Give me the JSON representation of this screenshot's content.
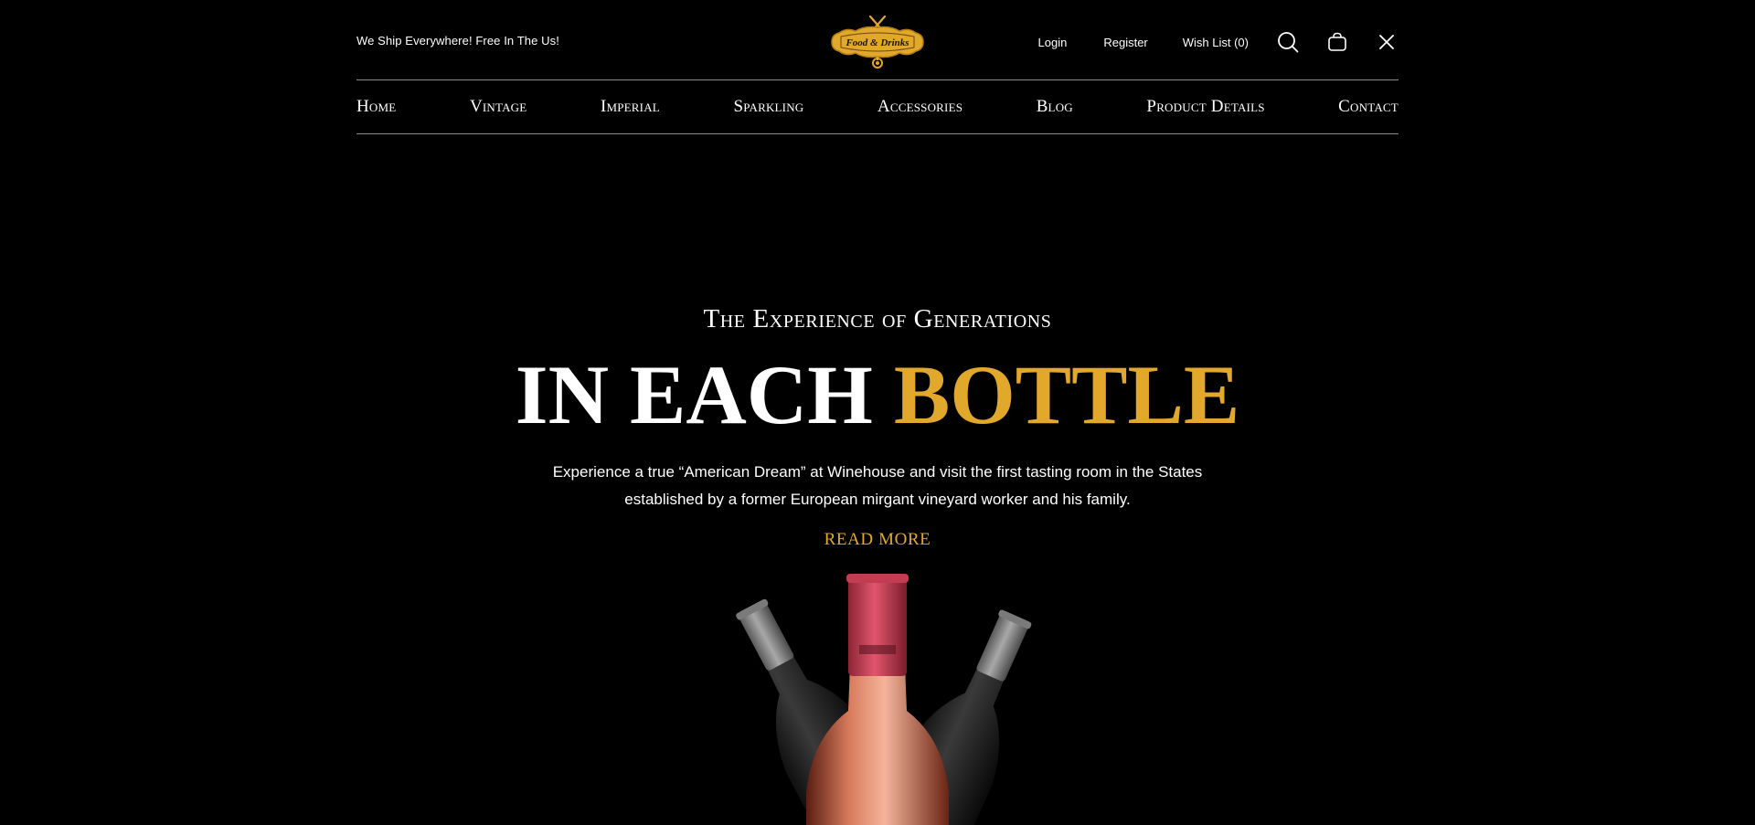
{
  "header": {
    "ship_note": "We Ship Everywhere! Free In The Us!",
    "logo_text": "Food & Drinks",
    "login": "Login",
    "register": "Register",
    "wishlist": "Wish List (0)"
  },
  "icons": {
    "search": "search-icon",
    "bag": "shopping-bag-icon",
    "close": "close-icon"
  },
  "nav": {
    "items": [
      {
        "label": "Home"
      },
      {
        "label": "Vintage"
      },
      {
        "label": "Imperial"
      },
      {
        "label": "Sparkling"
      },
      {
        "label": "Accessories"
      },
      {
        "label": "Blog"
      },
      {
        "label": "Product Details"
      },
      {
        "label": "Contact"
      }
    ]
  },
  "hero": {
    "eyebrow": "The Experience of Generations",
    "headline_white": "In each",
    "headline_gold": "bottle",
    "description": "Experience a true “American Dream” at Winehouse and visit the first tasting room in the States established by a former European mirgant vineyard worker and his family.",
    "read_more": "READ MORE"
  },
  "colors": {
    "background": "#000000",
    "accent_gold": "#e2a82c",
    "text": "#ffffff"
  }
}
